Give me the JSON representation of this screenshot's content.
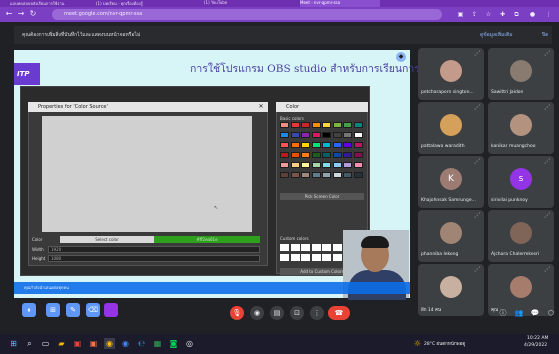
{
  "browser": {
    "tabs": [
      {
        "label": "แบบทดสอบหลังเรียนการใช้งาน"
      },
      {
        "label": "(1) บทเรียน - ทุกเรื่องต้องรู้"
      },
      {
        "label": "(1) YouTube"
      },
      {
        "label": "Meet - nvr-qpmr-ssa",
        "active": true
      }
    ],
    "url": "meet.google.com/nvr-qpmr-ssa"
  },
  "banner": {
    "text": "คุณต้องการเพิ่มสิ่งที่บันทึกไว้และแสดงบนหน้าจอหรือไม่",
    "link": "ดูข้อมูลเพิ่มเติม",
    "close": "ปิด"
  },
  "presentation": {
    "slide_title": "การใช้โปรแกรม OBS studio สำหรับการเรียนการสอนออนไลน์",
    "logo": "ITP",
    "props_title": "Properties for 'Color Source'",
    "color_title": "Color",
    "color_label": "Color",
    "width_label": "Width",
    "height_label": "Height",
    "width_value": "1920",
    "height_value": "1080",
    "select_color": "Select color",
    "color_value": "#ff2ea01e",
    "basic_colors": "Basic colors",
    "pick_screen": "Pick Screen Color",
    "custom_colors": "Custom colors",
    "add_custom": "Add to Custom Colors",
    "bar_text": "คุณกำลังนำเสนอต่อทุกคน"
  },
  "participants": [
    {
      "name": "petcharaporn sington...",
      "avatar_color": "#c49a8a",
      "initial": ""
    },
    {
      "name": "Sawittri Jaidon",
      "avatar_color": "#8a7b70",
      "initial": ""
    },
    {
      "name": "pattalawa waradith",
      "avatar_color": "#d4a05a",
      "initial": ""
    },
    {
      "name": "kanikar muangchoo",
      "avatar_color": "#b39280",
      "initial": ""
    },
    {
      "name": "Khajohnsak Samrunge...",
      "avatar_color": "#9c7b73",
      "initial": "K"
    },
    {
      "name": "sirivilai punknoy",
      "avatar_color": "#9334e6",
      "initial": "s"
    },
    {
      "name": "phanniba lekong",
      "avatar_color": "#a08474",
      "initial": ""
    },
    {
      "name": "Ajchara Chalermkesri",
      "avatar_color": "#7f6458",
      "initial": ""
    },
    {
      "name": "อีก 14 คน",
      "avatar_color": "#c8b0a0",
      "initial": ""
    },
    {
      "name": "คุณ",
      "avatar_color": "#a67c6d",
      "initial": ""
    }
  ],
  "meet_controls": {
    "mic": "mic-off-icon",
    "camera": "camera-icon",
    "captions": "captions-icon",
    "present": "present-icon",
    "more": "more-icon",
    "end": "end-call-icon"
  },
  "taskbar": {
    "weather": "28°C ฝนตกหนักพอดู",
    "time": "10:22 AM",
    "date": "4/29/2022"
  }
}
